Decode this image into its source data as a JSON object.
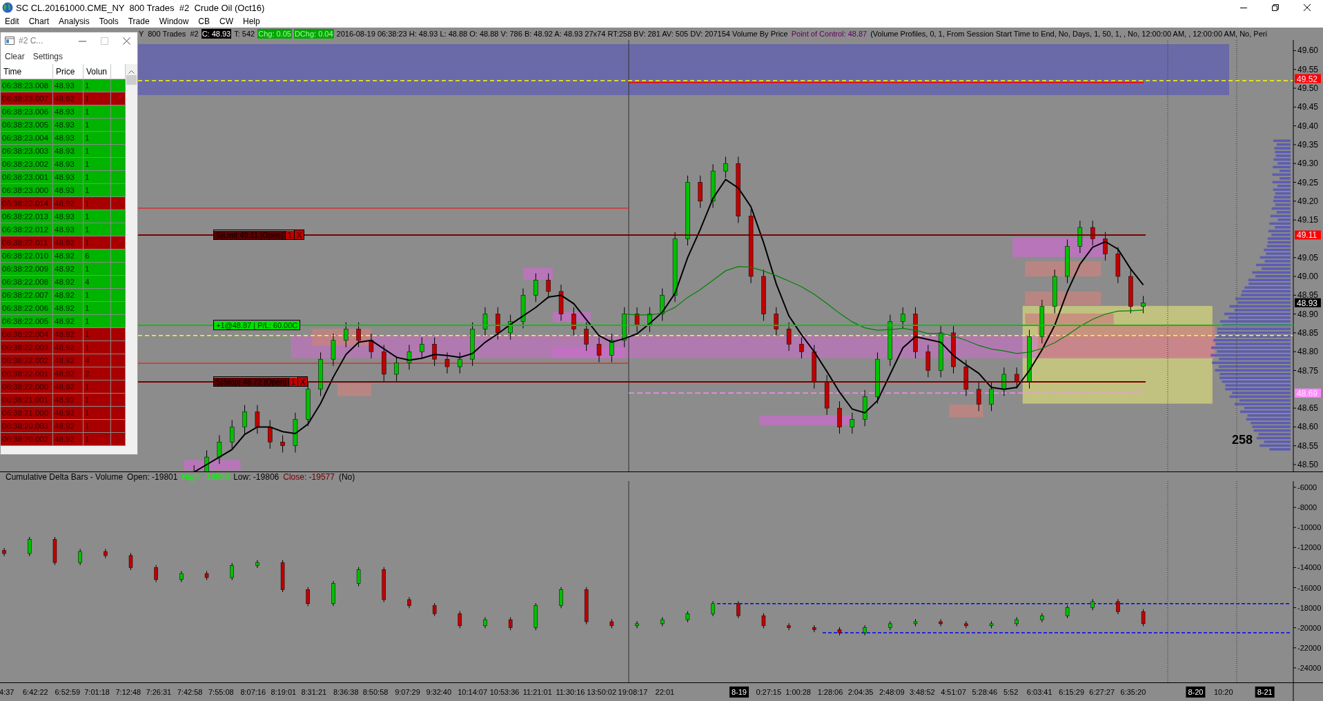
{
  "window": {
    "title": "SC CL.20161000.CME_NY  800 Trades  #2  Crude Oil (Oct16)"
  },
  "menu": [
    "Edit",
    "Chart",
    "Analysis",
    "Tools",
    "Trade",
    "Window",
    "CB",
    "CW",
    "Help"
  ],
  "chart_header": [
    {
      "text": "Y  800 Trades  #2",
      "kind": "plain"
    },
    {
      "text": "C: 48.93",
      "kind": "last"
    },
    {
      "text": "T: 542",
      "kind": "plain"
    },
    {
      "text": "Chg: 0.05",
      "kind": "change"
    },
    {
      "text": "DChg: 0.04",
      "kind": "change"
    },
    {
      "text": "2016-08-19 06:38:23 H: 48.93 L: 48.88 O: 48.88 V: 786 B: 48.92 A: 48.93 27x74 RT:258 BV: 281 AV: 505 DV: 207154 Volume By Price",
      "kind": "plain"
    },
    {
      "text": "Point of Control: 48.87",
      "kind": "poc"
    },
    {
      "text": "(Volume Profiles, 0, 1, From Session Start Time to End, No, Days, 1, 50, 1, , No, 12:00:00 AM, , 12:00:00 AM, No, Peri",
      "kind": "plain"
    }
  ],
  "price_chart": {
    "axis_labels": [
      "49.60",
      "49.55",
      "49.50",
      "49.45",
      "49.40",
      "49.35",
      "49.30",
      "49.25",
      "49.20",
      "49.15",
      "49.05",
      "49.00",
      "48.95",
      "48.90",
      "48.85",
      "48.80",
      "48.75",
      "48.65",
      "48.60",
      "48.55",
      "48.50"
    ],
    "orders": [
      {
        "kind": "limit",
        "text": "S|Lmt| 49.11 |Open|",
        "quantity": "1",
        "cancel": "X"
      },
      {
        "kind": "position",
        "text": "+1@48.87 | P/L: 60.00C"
      },
      {
        "kind": "stop",
        "text": "S|Stop| 48.72 |Open|",
        "quantity": "1",
        "cancel": "X"
      }
    ],
    "bar_count": "258",
    "price_tags": [
      {
        "text": "49.52",
        "color": "#ff0000"
      },
      {
        "text": "49.11",
        "color": "#ff0000"
      },
      {
        "text": "48.93",
        "color": "#000000"
      },
      {
        "text": "48.69",
        "color": "#ff88ff"
      }
    ]
  },
  "delta_chart": {
    "header": [
      {
        "text": "Cumulative Delta Bars - Volume",
        "kind": "plain"
      },
      {
        "text": "Open: -19801",
        "kind": "plain"
      },
      {
        "text": "High: -19559",
        "kind": "high"
      },
      {
        "text": "Low: -19806",
        "kind": "plain"
      },
      {
        "text": "Close: -19577",
        "kind": "close"
      },
      {
        "text": "(No)",
        "kind": "plain"
      }
    ],
    "axis_labels": [
      "-6000",
      "-8000",
      "-10000",
      "-12000",
      "-14000",
      "-16000",
      "-18000",
      "-20000",
      "-22000",
      "-24000"
    ]
  },
  "time_axis": [
    {
      "label": "4:37",
      "highlighted": false
    },
    {
      "label": "6:42:22",
      "highlighted": false
    },
    {
      "label": "6:52:59",
      "highlighted": false
    },
    {
      "label": "7:01:18",
      "highlighted": false
    },
    {
      "label": "7:12:48",
      "highlighted": false
    },
    {
      "label": "7:26:31",
      "highlighted": false
    },
    {
      "label": "7:42:58",
      "highlighted": false
    },
    {
      "label": "7:55:08",
      "highlighted": false
    },
    {
      "label": "8:07:16",
      "highlighted": false
    },
    {
      "label": "8:19:01",
      "highlighted": false
    },
    {
      "label": "8:31:21",
      "highlighted": false
    },
    {
      "label": "8:36:38",
      "highlighted": false
    },
    {
      "label": "8:50:58",
      "highlighted": false
    },
    {
      "label": "9:07:29",
      "highlighted": false
    },
    {
      "label": "9:32:40",
      "highlighted": false
    },
    {
      "label": "10:14:07",
      "highlighted": false
    },
    {
      "label": "10:53:36",
      "highlighted": false
    },
    {
      "label": "11:21:01",
      "highlighted": false
    },
    {
      "label": "11:30:16",
      "highlighted": false
    },
    {
      "label": "13:50:02",
      "highlighted": false
    },
    {
      "label": "19:08:17",
      "highlighted": false
    },
    {
      "label": "22:01",
      "highlighted": false
    },
    {
      "label": "8-19",
      "highlighted": true
    },
    {
      "label": "0:27:15",
      "highlighted": false
    },
    {
      "label": "1:00:28",
      "highlighted": false
    },
    {
      "label": "1:28:06",
      "highlighted": false
    },
    {
      "label": "2:04:35",
      "highlighted": false
    },
    {
      "label": "2:48:09",
      "highlighted": false
    },
    {
      "label": "3:48:52",
      "highlighted": false
    },
    {
      "label": "4:51:07",
      "highlighted": false
    },
    {
      "label": "5:28:46",
      "highlighted": false
    },
    {
      "label": "5:52",
      "highlighted": false
    },
    {
      "label": "6:03:41",
      "highlighted": false
    },
    {
      "label": "6:15:29",
      "highlighted": false
    },
    {
      "label": "6:27:27",
      "highlighted": false
    },
    {
      "label": "6:35:20",
      "highlighted": false
    },
    {
      "label": "8-20",
      "highlighted": true
    },
    {
      "label": "10:20",
      "highlighted": false
    },
    {
      "label": "8-21",
      "highlighted": true
    }
  ],
  "time_sales": {
    "title": "#2 C...",
    "menu": [
      "Clear",
      "Settings"
    ],
    "columns": [
      "Time",
      "Price",
      "Volun"
    ],
    "rows": [
      {
        "time": "06:38:23.008",
        "price": "48.93",
        "volume": "1",
        "kind": "buy"
      },
      {
        "time": "06:38:23.007",
        "price": "48.92",
        "volume": "1",
        "kind": "sell"
      },
      {
        "time": "06:38:23.006",
        "price": "48.93",
        "volume": "1",
        "kind": "buy"
      },
      {
        "time": "06:38:23.005",
        "price": "48.93",
        "volume": "1",
        "kind": "buy"
      },
      {
        "time": "06:38:23.004",
        "price": "48.93",
        "volume": "1",
        "kind": "buy"
      },
      {
        "time": "06:38:23.003",
        "price": "48.93",
        "volume": "1",
        "kind": "buy"
      },
      {
        "time": "06:38:23.002",
        "price": "48.93",
        "volume": "1",
        "kind": "buy"
      },
      {
        "time": "06:38:23.001",
        "price": "48.93",
        "volume": "1",
        "kind": "buy"
      },
      {
        "time": "06:38:23.000",
        "price": "48.93",
        "volume": "1",
        "kind": "buy"
      },
      {
        "time": "06:38:22.014",
        "price": "48.92",
        "volume": "1",
        "kind": "sell"
      },
      {
        "time": "06:38:22.013",
        "price": "48.93",
        "volume": "1",
        "kind": "buy"
      },
      {
        "time": "06:38:22.012",
        "price": "48.93",
        "volume": "1",
        "kind": "buy"
      },
      {
        "time": "06:38:22.011",
        "price": "48.92",
        "volume": "1",
        "kind": "sell"
      },
      {
        "time": "06:38:22.010",
        "price": "48.92",
        "volume": "6",
        "kind": "buy"
      },
      {
        "time": "06:38:22.009",
        "price": "48.92",
        "volume": "1",
        "kind": "buy"
      },
      {
        "time": "06:38:22.008",
        "price": "48.92",
        "volume": "4",
        "kind": "buy"
      },
      {
        "time": "06:38:22.007",
        "price": "48.92",
        "volume": "1",
        "kind": "buy"
      },
      {
        "time": "06:38:22.006",
        "price": "48.92",
        "volume": "1",
        "kind": "buy"
      },
      {
        "time": "06:38:22.005",
        "price": "48.92",
        "volume": "1",
        "kind": "buy"
      },
      {
        "time": "06:38:22.004",
        "price": "48.92",
        "volume": "1",
        "kind": "sell"
      },
      {
        "time": "06:38:22.003",
        "price": "48.92",
        "volume": "1",
        "kind": "sell"
      },
      {
        "time": "06:38:22.002",
        "price": "48.92",
        "volume": "4",
        "kind": "sell"
      },
      {
        "time": "06:38:22.001",
        "price": "48.92",
        "volume": "2",
        "kind": "sell"
      },
      {
        "time": "06:38:22.000",
        "price": "48.92",
        "volume": "1",
        "kind": "sell"
      },
      {
        "time": "06:38:21.001",
        "price": "48.92",
        "volume": "1",
        "kind": "sell"
      },
      {
        "time": "06:38:21.000",
        "price": "48.92",
        "volume": "1",
        "kind": "sell"
      },
      {
        "time": "06:38:20.003",
        "price": "48.92",
        "volume": "1",
        "kind": "sell"
      },
      {
        "time": "06:38:20.002",
        "price": "48.92",
        "volume": "1",
        "kind": "sell"
      }
    ]
  }
}
